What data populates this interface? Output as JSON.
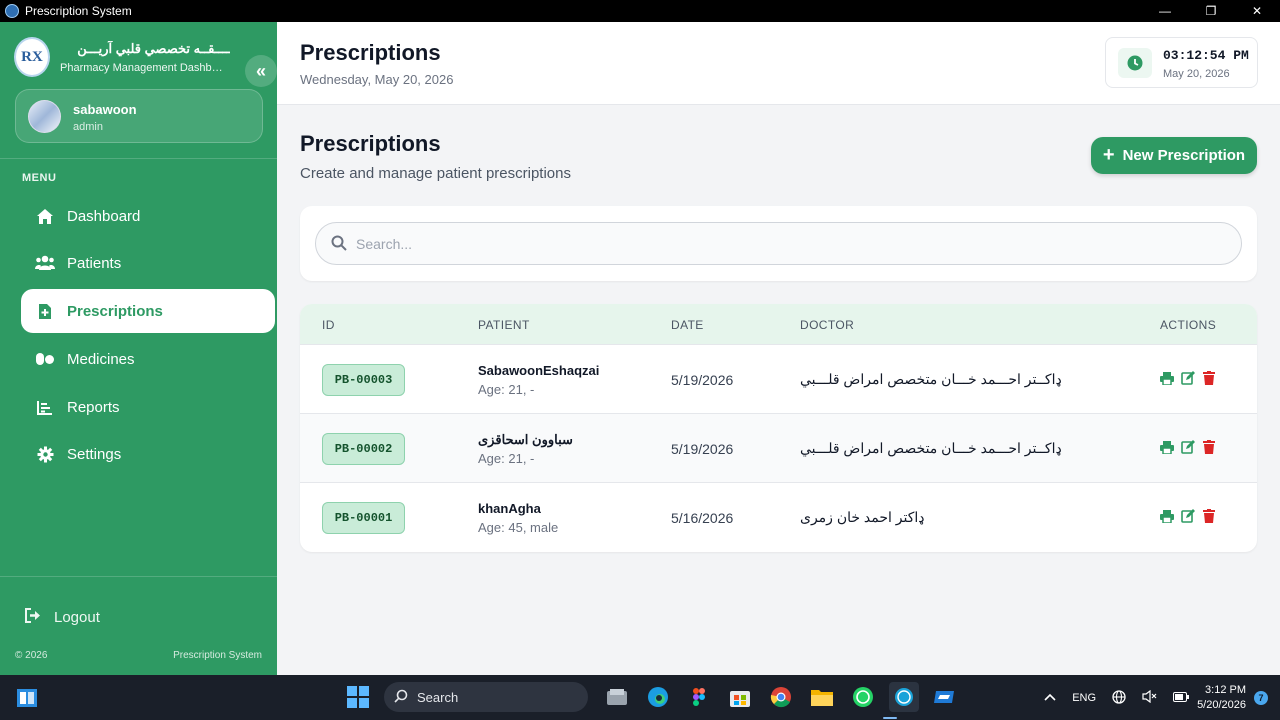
{
  "window": {
    "title": "Prescription System",
    "minimize": "—",
    "maximize": "❐",
    "close": "✕"
  },
  "sidebar": {
    "brand_name": "ــــقــه تخصصي قلبي آريـــن",
    "brand_sub": "Pharmacy Management Dashboard",
    "logo_text": "RX",
    "collapse": "«",
    "user": {
      "name": "sabawoon",
      "role": "admin"
    },
    "menu_title": "MENU",
    "items": [
      {
        "label": "Dashboard",
        "icon": "home-icon"
      },
      {
        "label": "Patients",
        "icon": "users-icon"
      },
      {
        "label": "Prescriptions",
        "icon": "prescription-file-icon",
        "active": true
      },
      {
        "label": "Medicines",
        "icon": "pills-icon"
      },
      {
        "label": "Reports",
        "icon": "chart-icon"
      },
      {
        "label": "Settings",
        "icon": "gear-icon"
      }
    ],
    "logout": "Logout",
    "copyright": "© 2026",
    "footer_app": "Prescription System"
  },
  "header": {
    "title": "Prescriptions",
    "date": "Wednesday, May 20, 2026",
    "clock_time": "03:12:54 PM",
    "clock_date": "May 20, 2026"
  },
  "page": {
    "title": "Prescriptions",
    "subtitle": "Create and manage patient prescriptions",
    "new_button": "New Prescription",
    "search_placeholder": "Search..."
  },
  "table": {
    "columns": [
      "ID",
      "PATIENT",
      "DATE",
      "DOCTOR",
      "ACTIONS"
    ],
    "rows": [
      {
        "id": "PB-00003",
        "patient": "SabawoonEshaqzai",
        "age": "Age: 21, -",
        "date": "5/19/2026",
        "doctor": "ډاکــتر احـــمد خـــان متخصص امراض قلـــبي"
      },
      {
        "id": "PB-00002",
        "patient": "سباوون اسحاقزی",
        "age": "Age: 21, -",
        "date": "5/19/2026",
        "doctor": "ډاکــتر احـــمد خـــان متخصص امراض قلـــبي"
      },
      {
        "id": "PB-00001",
        "patient": "khanAgha",
        "age": "Age: 45, male",
        "date": "5/16/2026",
        "doctor": "ډاکتر احمد خان زمری"
      }
    ]
  },
  "colors": {
    "primary": "#2e9a63",
    "danger": "#dc2626",
    "header_bg": "#e6f5ec"
  },
  "taskbar": {
    "search": "Search",
    "tray_lang": "ENG",
    "time": "3:12 PM",
    "date": "5/20/2026",
    "notifications": "7",
    "apps": [
      "file-explorer-icon",
      "edge-icon",
      "figma-icon",
      "store-icon",
      "chrome-icon",
      "folder-icon",
      "whatsapp-icon",
      "prescription-app-icon",
      "remote-app-icon"
    ]
  }
}
